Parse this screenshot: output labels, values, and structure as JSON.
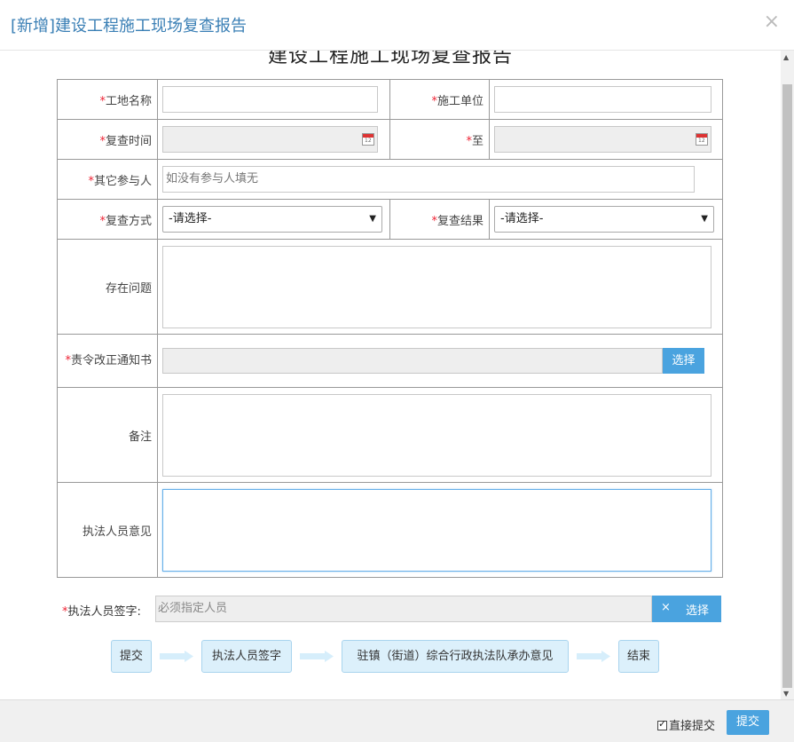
{
  "dialog": {
    "title": "[新增]建设工程施工现场复查报告",
    "close": "×"
  },
  "report_title": "建设工程施工现场复查报告",
  "required_mark": "*",
  "form": {
    "site_name_label": "工地名称",
    "site_name_value": "",
    "construction_unit_label": "施工单位",
    "construction_unit_value": "",
    "review_time_label": "复查时间",
    "review_time_value": "",
    "to_label": "至",
    "to_value": "",
    "other_participants_label": "其它参与人",
    "other_participants_placeholder": "如没有参与人填无",
    "review_method_label": "复查方式",
    "review_method_selected": "-请选择-",
    "review_result_label": "复查结果",
    "review_result_selected": "-请选择-",
    "issues_label": "存在问题",
    "rectification_notice_label": "责令改正通知书",
    "rectification_choose": "选择",
    "remarks_label": "备注",
    "officer_opinion_label": "执法人员意见"
  },
  "signature": {
    "label": "执法人员签字:",
    "placeholder": "必须指定人员",
    "clear": "×",
    "choose": "选择"
  },
  "flow": {
    "steps": [
      "提交",
      "执法人员签字",
      "驻镇（街道）综合行政执法队承办意见",
      "结束"
    ]
  },
  "footer": {
    "direct_submit_label": "直接提交",
    "direct_submit_checked": true,
    "submit_label": "提交"
  },
  "colors": {
    "accent": "#4aa3df",
    "title": "#3a7fb5",
    "required": "#ee2233",
    "flow_step_bg": "#dcf0fb"
  }
}
